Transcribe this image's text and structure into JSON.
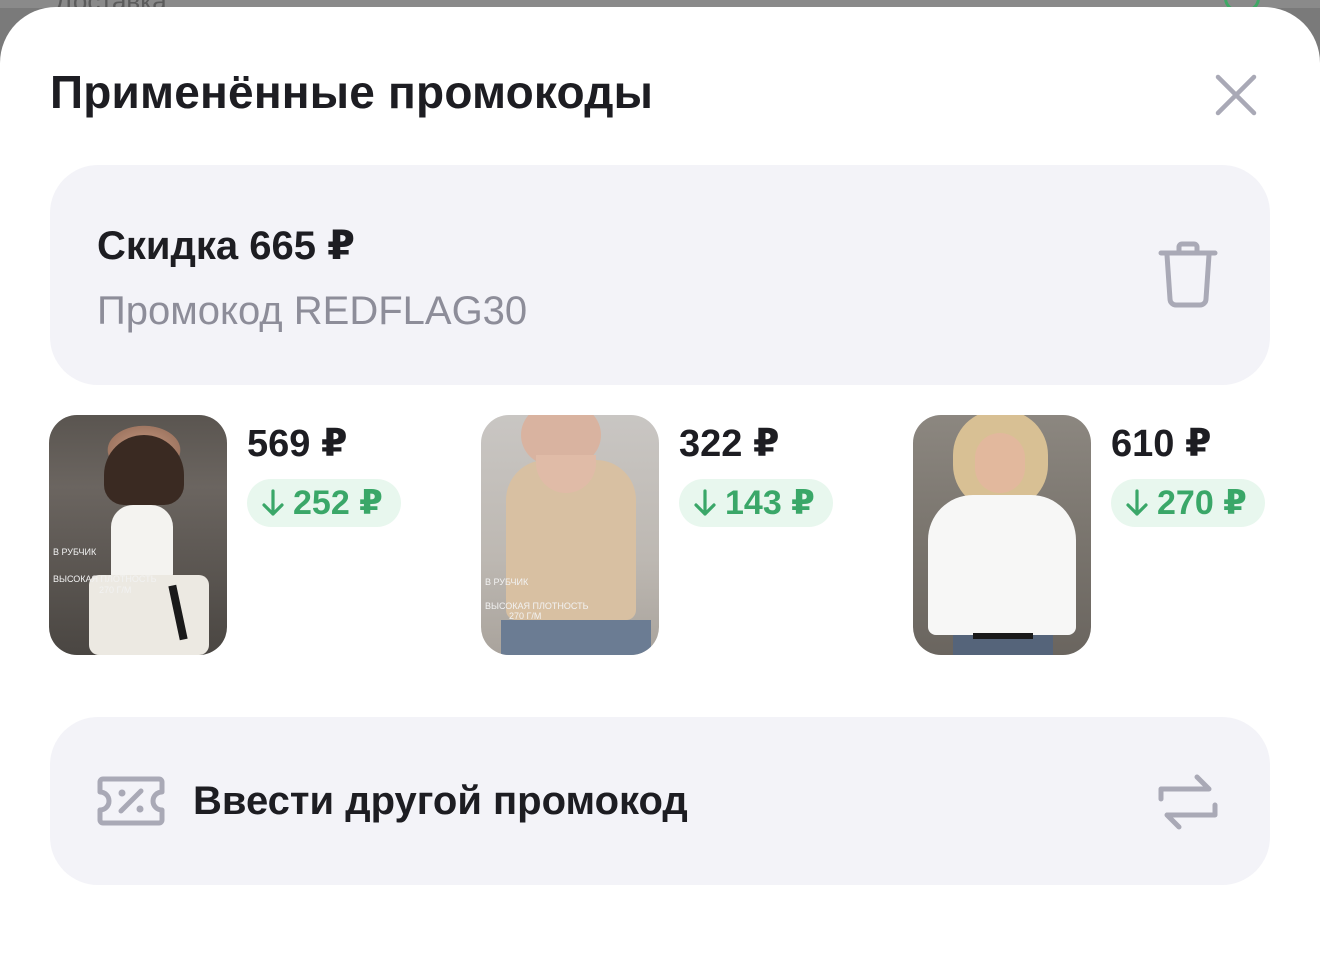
{
  "backdrop": {
    "title_fragment": "Доставка"
  },
  "header": {
    "title": "Применённые промокоды",
    "close_icon": "close-icon"
  },
  "discount": {
    "title": "Скидка 665 ₽",
    "subtitle": "Промокод REDFLAG30",
    "delete_icon": "trash-icon"
  },
  "products": [
    {
      "price": "569 ₽",
      "saving": "252 ₽",
      "thumb_lines": [
        "В РУБЧИК",
        "ВЫСОКАЯ ПЛОТНОСТЬ",
        "270 Г/М"
      ]
    },
    {
      "price": "322 ₽",
      "saving": "143 ₽",
      "thumb_lines": [
        "В РУБЧИК",
        "ВЫСОКАЯ ПЛОТНОСТЬ",
        "270 Г/М"
      ]
    },
    {
      "price": "610 ₽",
      "saving": "270 ₽",
      "thumb_lines": []
    }
  ],
  "enter_other": {
    "label": "Ввести другой промокод",
    "icon": "discount-ticket-icon",
    "action_icon": "swap-arrows-icon"
  },
  "colors": {
    "accent_green": "#3aa768",
    "green_badge_bg": "#e8f7ee",
    "card_bg": "#f3f3f8",
    "muted_text": "#8d8d99",
    "icon_gray": "#a9a9b6"
  }
}
